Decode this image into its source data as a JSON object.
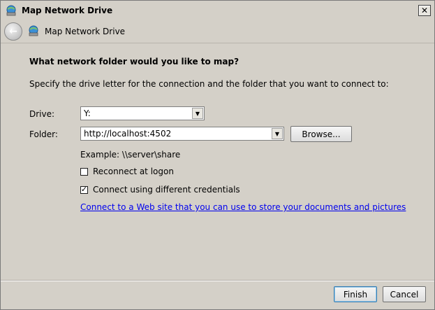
{
  "window": {
    "title": "Map Network Drive",
    "close_glyph": "✕"
  },
  "nav": {
    "back_glyph": "←",
    "title": "Map Network Drive"
  },
  "main": {
    "heading": "What network folder would you like to map?",
    "description": "Specify the drive letter for the connection and the folder that you want to connect to:",
    "drive_label": "Drive:",
    "drive_value": "Y:",
    "folder_label": "Folder:",
    "folder_value": "http://localhost:4502",
    "browse_label": "Browse...",
    "example_text": "Example: \\\\server\\share",
    "reconnect_label": "Reconnect at logon",
    "reconnect_checked": false,
    "credentials_label": "Connect using different credentials",
    "credentials_checked": true,
    "check_glyph": "✓",
    "web_link_text": "Connect to a Web site that you can use to store your documents and pictures",
    "web_link_suffix": "."
  },
  "footer": {
    "finish_label": "Finish",
    "cancel_label": "Cancel"
  },
  "icons": {
    "title_icon": "network-drive-icon",
    "nav_icon": "network-drive-icon",
    "back_icon": "back-arrow-icon",
    "close_icon": "close-icon",
    "dropdown_icon": "chevron-down-icon"
  }
}
